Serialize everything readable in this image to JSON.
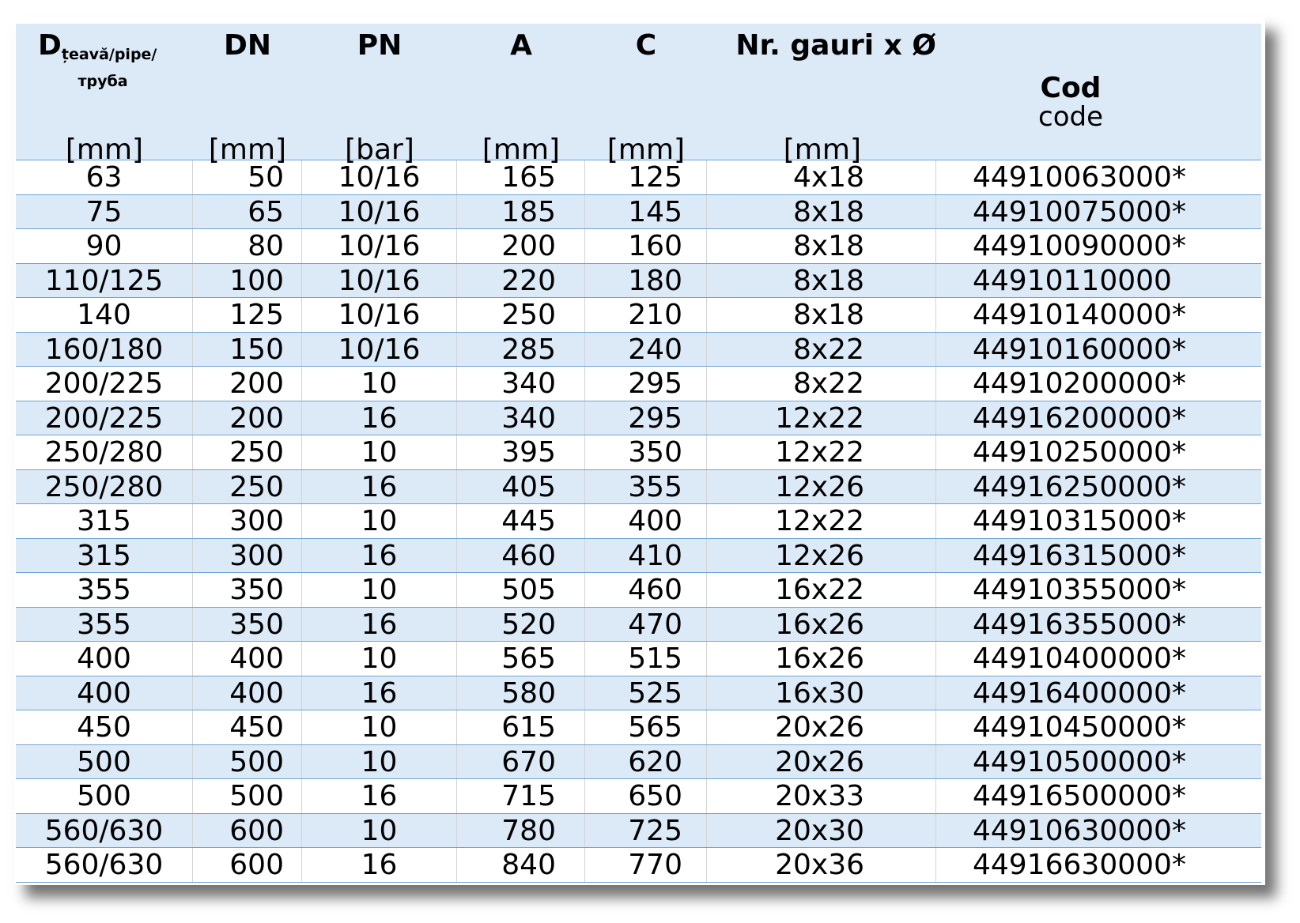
{
  "header": {
    "col_d": {
      "label": "D",
      "sub": "țeavă/pipe/",
      "sub2": "труба",
      "unit": "[mm]"
    },
    "col_dn": {
      "label": "DN",
      "unit": "[mm]"
    },
    "col_pn": {
      "label": "PN",
      "unit": "[bar]"
    },
    "col_a": {
      "label": "A",
      "unit": "[mm]"
    },
    "col_c": {
      "label": "C",
      "unit": "[mm]"
    },
    "col_holes": {
      "label": "Nr. gauri x Ø",
      "unit": "[mm]"
    },
    "col_code": {
      "label": "Cod",
      "sub": "code"
    }
  },
  "rows": [
    [
      "63",
      "50",
      "10/16",
      "165",
      "125",
      "4x18",
      "44910063000*"
    ],
    [
      "75",
      "65",
      "10/16",
      "185",
      "145",
      "8x18",
      "44910075000*"
    ],
    [
      "90",
      "80",
      "10/16",
      "200",
      "160",
      "8x18",
      "44910090000*"
    ],
    [
      "110/125",
      "100",
      "10/16",
      "220",
      "180",
      "8x18",
      "44910110000"
    ],
    [
      "140",
      "125",
      "10/16",
      "250",
      "210",
      "8x18",
      "44910140000*"
    ],
    [
      "160/180",
      "150",
      "10/16",
      "285",
      "240",
      "8x22",
      "44910160000*"
    ],
    [
      "200/225",
      "200",
      "10",
      "340",
      "295",
      "8x22",
      "44910200000*"
    ],
    [
      "200/225",
      "200",
      "16",
      "340",
      "295",
      "12x22",
      "44916200000*"
    ],
    [
      "250/280",
      "250",
      "10",
      "395",
      "350",
      "12x22",
      "44910250000*"
    ],
    [
      "250/280",
      "250",
      "16",
      "405",
      "355",
      "12x26",
      "44916250000*"
    ],
    [
      "315",
      "300",
      "10",
      "445",
      "400",
      "12x22",
      "44910315000*"
    ],
    [
      "315",
      "300",
      "16",
      "460",
      "410",
      "12x26",
      "44916315000*"
    ],
    [
      "355",
      "350",
      "10",
      "505",
      "460",
      "16x22",
      "44910355000*"
    ],
    [
      "355",
      "350",
      "16",
      "520",
      "470",
      "16x26",
      "44916355000*"
    ],
    [
      "400",
      "400",
      "10",
      "565",
      "515",
      "16x26",
      "44910400000*"
    ],
    [
      "400",
      "400",
      "16",
      "580",
      "525",
      "16x30",
      "44916400000*"
    ],
    [
      "450",
      "450",
      "10",
      "615",
      "565",
      "20x26",
      "44910450000*"
    ],
    [
      "500",
      "500",
      "10",
      "670",
      "620",
      "20x26",
      "44910500000*"
    ],
    [
      "500",
      "500",
      "16",
      "715",
      "650",
      "20x33",
      "44916500000*"
    ],
    [
      "560/630",
      "600",
      "10",
      "780",
      "725",
      "20x30",
      "44910630000*"
    ],
    [
      "560/630",
      "600",
      "16",
      "840",
      "770",
      "20x36",
      "44916630000*"
    ]
  ]
}
